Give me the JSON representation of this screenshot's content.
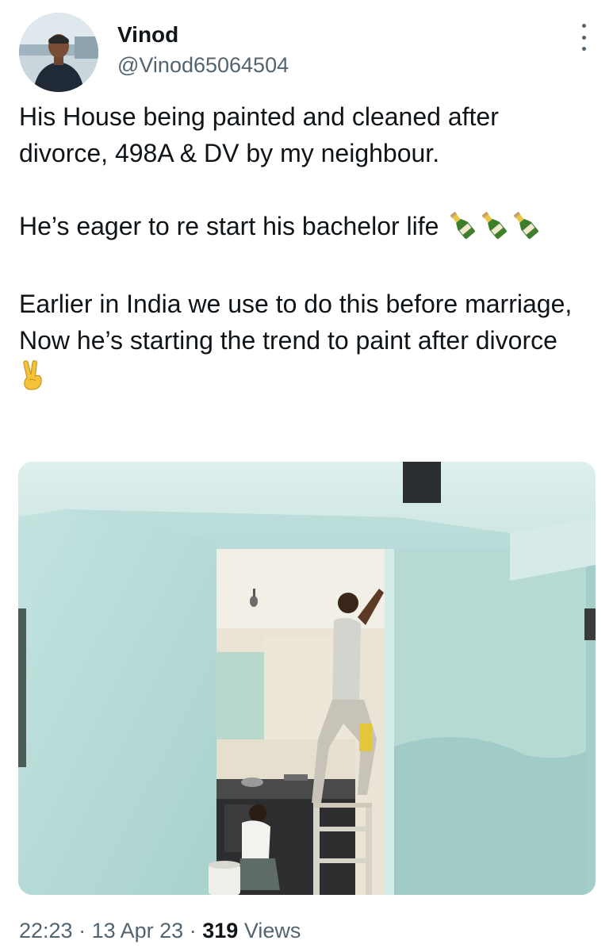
{
  "author": {
    "display_name": "Vinod",
    "handle": "@Vinod65064504"
  },
  "tweet": {
    "paragraph_1": "His House being painted and cleaned after divorce, 498A & DV by my neighbour.",
    "paragraph_2": "He’s eager to re start his bachelor life",
    "paragraph_2_emoji": "🍾🍾🍾",
    "paragraph_3": "Earlier in India we use to do this before marriage, Now he’s starting the trend to paint after divorce",
    "paragraph_3_emoji": "✌️"
  },
  "media": {
    "type": "photo"
  },
  "meta": {
    "time": "22:23",
    "separator": "·",
    "date": "13 Apr 23",
    "views_count": "319",
    "views_label": "Views"
  },
  "icons": [
    "more-options-icon",
    "champagne-bottle-icon",
    "victory-hand-icon"
  ],
  "colors": {
    "text_primary": "#0f1419",
    "text_secondary": "#536471",
    "wall_paint": "#b9dcd8"
  }
}
